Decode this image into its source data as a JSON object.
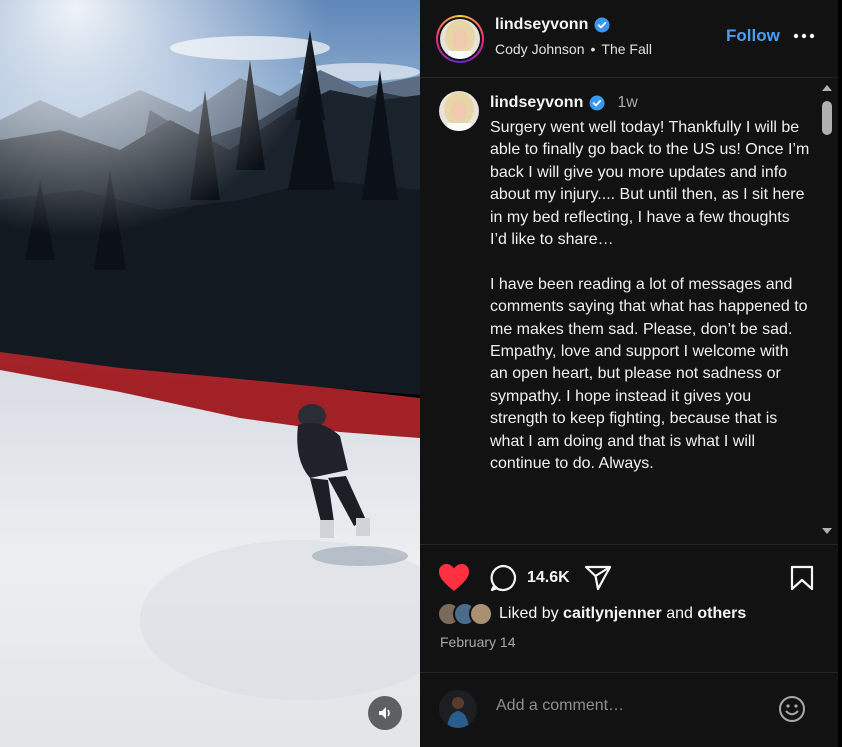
{
  "media": {
    "mute_icon": "speaker-icon"
  },
  "header": {
    "username": "lindseyvonn",
    "song_artist": "Cody Johnson",
    "song_sep": "•",
    "song_title": "The Fall",
    "follow_label": "Follow",
    "more_icon": "more-horizontal-icon"
  },
  "caption": {
    "username": "lindseyvonn",
    "time": "1w",
    "text": "Surgery went well today! Thankfully I will be able to finally go back to the US us! Once I’m back I will give you more updates and info about my injury.... But until then, as I sit here in my bed reflecting, I have a few thoughts I’d like to share…\n\nI have been reading a lot of messages and comments saying that what has happened to me makes them sad. Please, don’t be sad. Empathy, love and support I welcome with an open heart, but please not sadness or sympathy. I hope instead it gives you strength to keep fighting, because that is what I am doing and that is what I will continue to do. Always."
  },
  "actions": {
    "comment_count": "14.6K",
    "like_color": "#ff3040"
  },
  "likes": {
    "prefix": "Liked by",
    "first_user": "caitlynjenner",
    "joiner": "and",
    "others": "others"
  },
  "date": "February 14",
  "comment_box": {
    "placeholder": "Add a comment…"
  },
  "colors": {
    "accent": "#4a9ff5",
    "panel_bg": "#121212",
    "verified": "#3897f0"
  }
}
